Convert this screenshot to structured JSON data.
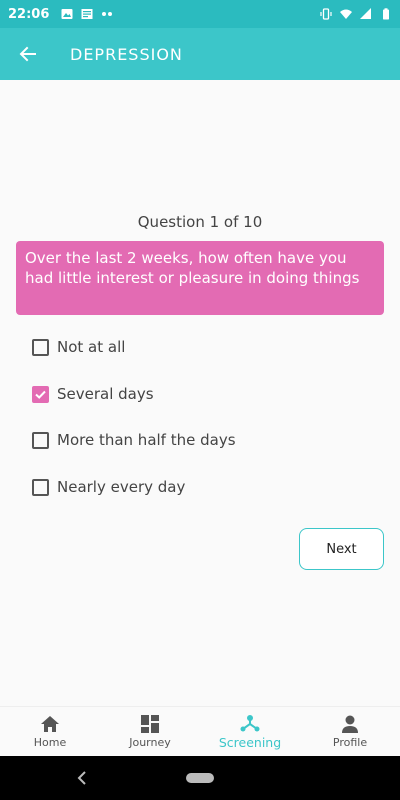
{
  "status_bar": {
    "time": "22:06",
    "left_icons": [
      "image-icon",
      "news-icon",
      "more-dots-icon"
    ],
    "right_icons": [
      "vibrate-icon",
      "wifi-icon",
      "signal-icon",
      "battery-icon"
    ]
  },
  "app_bar": {
    "title": "DEPRESSION",
    "back_icon": "arrow-left-icon"
  },
  "question": {
    "counter": "Question 1 of 10",
    "text": "Over the last 2 weeks, how often have you had little interest or pleasure in doing things"
  },
  "options": [
    {
      "label": "Not at all",
      "checked": false
    },
    {
      "label": "Several days",
      "checked": true
    },
    {
      "label": "More than half the days",
      "checked": false
    },
    {
      "label": "Nearly every day",
      "checked": false
    }
  ],
  "next_label": "Next",
  "bottom_nav": [
    {
      "label": "Home",
      "icon": "home-icon",
      "active": false
    },
    {
      "label": "Journey",
      "icon": "dashboard-icon",
      "active": false
    },
    {
      "label": "Screening",
      "icon": "network-icon",
      "active": true
    },
    {
      "label": "Profile",
      "icon": "person-icon",
      "active": false
    }
  ],
  "colors": {
    "primary": "#3cc6c9",
    "status_bar": "#2bbbbf",
    "accent": "#e36bb3"
  }
}
